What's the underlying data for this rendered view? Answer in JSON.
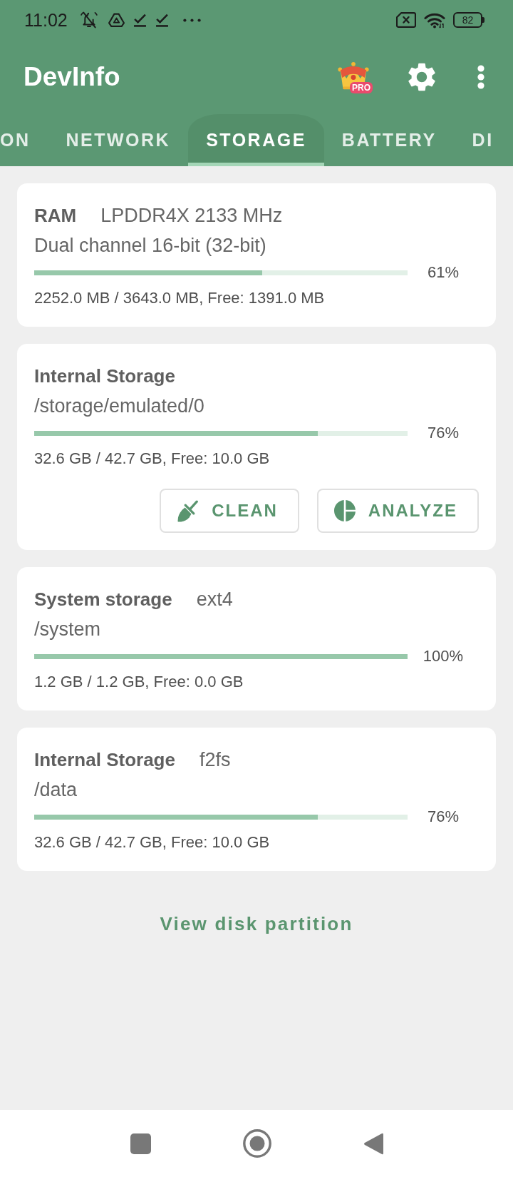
{
  "status_bar": {
    "time": "11:02",
    "battery": "82"
  },
  "app_bar": {
    "title": "DevInfo",
    "badge": "PRO"
  },
  "tabs": [
    {
      "label": "ON",
      "selected": false
    },
    {
      "label": "NETWORK",
      "selected": false
    },
    {
      "label": "STORAGE",
      "selected": true
    },
    {
      "label": "BATTERY",
      "selected": false
    },
    {
      "label": "DI",
      "selected": false
    }
  ],
  "cards": [
    {
      "title": "RAM",
      "value": "LPDDR4X 2133 MHz",
      "subtitle": "Dual channel 16-bit (32-bit)",
      "level": 0.61,
      "percent": "61%",
      "details": "2252.0 MB / 3643.0 MB, Free: 1391.0 MB"
    },
    {
      "title": "Internal Storage",
      "subtitle": "/storage/emulated/0",
      "level": 0.76,
      "percent": "76%",
      "details": "32.6 GB / 42.7 GB, Free: 10.0 GB",
      "buttons": [
        {
          "kind": "clean",
          "label": "CLEAN"
        },
        {
          "kind": "analyze",
          "label": "ANALYZE"
        }
      ]
    },
    {
      "title": "System storage",
      "value": "ext4",
      "subtitle": "/system",
      "level": 1,
      "percent": "100%",
      "details": "1.2 GB / 1.2 GB, Free: 0.0 GB"
    },
    {
      "title": "Internal Storage",
      "value": "f2fs",
      "subtitle": "/data",
      "level": 0.76,
      "percent": "76%",
      "details": "32.6 GB / 42.7 GB, Free: 10.0 GB"
    }
  ],
  "link": {
    "label": "View disk partition"
  }
}
